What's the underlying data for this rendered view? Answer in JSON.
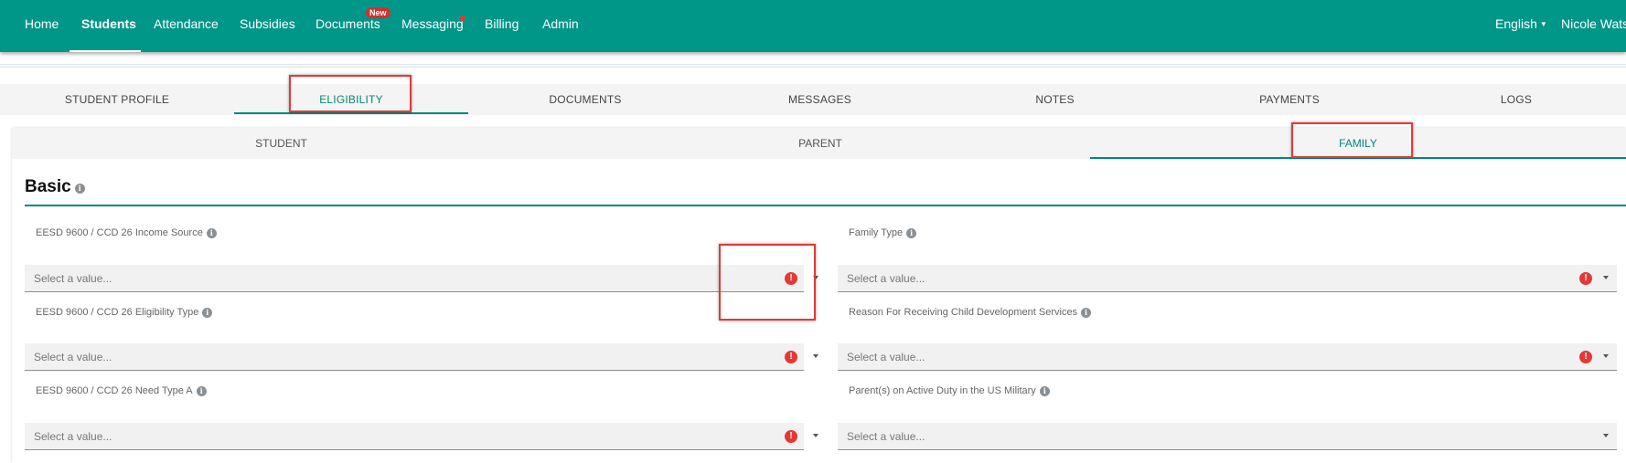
{
  "topnav": {
    "items": [
      "Home",
      "Students",
      "Attendance",
      "Subsidies",
      "Documents",
      "Messaging",
      "Billing",
      "Admin"
    ],
    "new_badge": "New",
    "language": "English",
    "user": "Nicole Watso"
  },
  "profile_tabs": [
    "STUDENT PROFILE",
    "ELIGIBILITY",
    "DOCUMENTS",
    "MESSAGES",
    "NOTES",
    "PAYMENTS",
    "LOGS"
  ],
  "sub_tabs": [
    "STUDENT",
    "PARENT",
    "FAMILY"
  ],
  "section": {
    "title": "Basic"
  },
  "fields": [
    {
      "label": "EESD 9600 / CCD 26 Income Source",
      "placeholder": "Select a value...",
      "error": true
    },
    {
      "label": "Family Type",
      "placeholder": "Select a value...",
      "error": true
    },
    {
      "label": "EESD 9600 / CCD 26 Eligibility Type",
      "placeholder": "Select a value...",
      "error": true
    },
    {
      "label": "Reason For Receiving Child Development Services",
      "placeholder": "Select a value...",
      "error": true
    },
    {
      "label": "EESD 9600 / CCD 26 Need Type A",
      "placeholder": "Select a value...",
      "error": true
    },
    {
      "label": "Parent(s) on Active Duty in the US Military",
      "placeholder": "Select a value...",
      "error": false
    }
  ],
  "icons": {
    "info": "info-icon",
    "error": "error-icon",
    "dropdown": "chevron-down-icon"
  },
  "colors": {
    "primary": "#009688",
    "accent": "#00897b",
    "error": "#e53935",
    "highlight": "#e53935"
  }
}
